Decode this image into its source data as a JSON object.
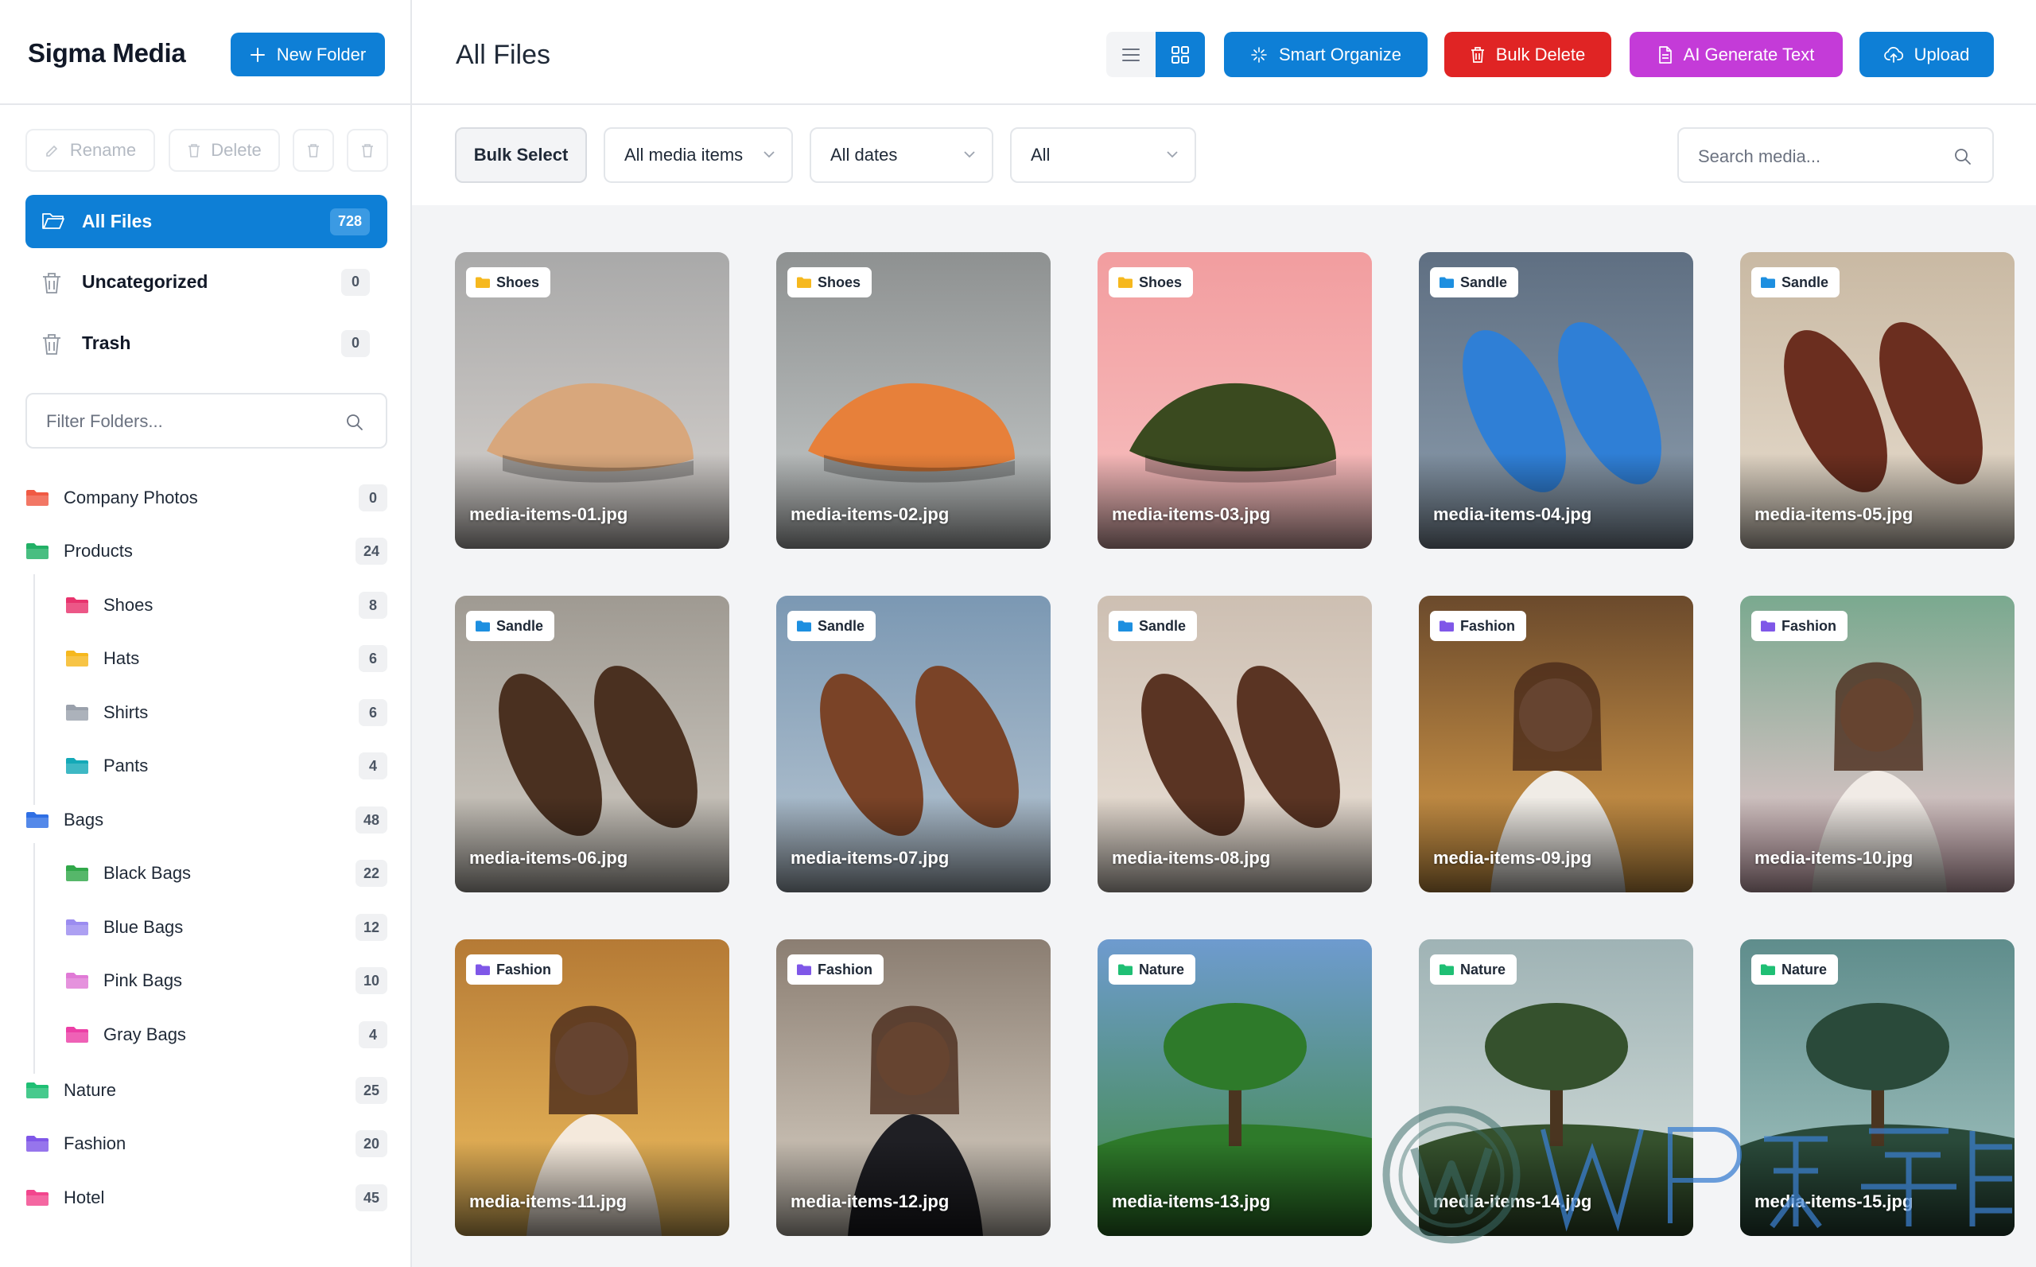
{
  "sidebar": {
    "brand": "Sigma Media",
    "new_folder_label": "New Folder",
    "rename_label": "Rename",
    "delete_label": "Delete",
    "nav": [
      {
        "label": "All Files",
        "count": "728"
      },
      {
        "label": "Uncategorized",
        "count": "0"
      },
      {
        "label": "Trash",
        "count": "0"
      }
    ],
    "filter_placeholder": "Filter Folders...",
    "folders": [
      {
        "label": "Company Photos",
        "count": "0",
        "color": "#f05a44"
      },
      {
        "label": "Products",
        "count": "24",
        "color": "#22b066"
      },
      {
        "label": "Shoes",
        "count": "8",
        "color": "#e8336d"
      },
      {
        "label": "Hats",
        "count": "6",
        "color": "#f6b81e"
      },
      {
        "label": "Shirts",
        "count": "6",
        "color": "#9aa1ac"
      },
      {
        "label": "Pants",
        "count": "4",
        "color": "#14a9b8"
      },
      {
        "label": "Bags",
        "count": "48",
        "color": "#2f6fe4"
      },
      {
        "label": "Black Bags",
        "count": "22",
        "color": "#31a84a"
      },
      {
        "label": "Blue Bags",
        "count": "12",
        "color": "#9b8cf0"
      },
      {
        "label": "Pink Bags",
        "count": "10",
        "color": "#e07ad6"
      },
      {
        "label": "Gray Bags",
        "count": "4",
        "color": "#ec3fa6"
      },
      {
        "label": "Nature",
        "count": "25",
        "color": "#1fbf74"
      },
      {
        "label": "Fashion",
        "count": "20",
        "color": "#7f57e8"
      },
      {
        "label": "Hotel",
        "count": "45",
        "color": "#f2468d"
      }
    ]
  },
  "header": {
    "title": "All Files",
    "smart_organize": "Smart Organize",
    "bulk_delete": "Bulk Delete",
    "ai_generate": "AI Generate Text",
    "upload": "Upload"
  },
  "filters": {
    "bulk_select": "Bulk Select",
    "media_type": "All media items",
    "dates": "All dates",
    "folder": "All",
    "search_placeholder": "Search media..."
  },
  "media": [
    {
      "folder": "Shoes",
      "name": "media-items-01.jpg",
      "folder_color": "#f6b81e"
    },
    {
      "folder": "Shoes",
      "name": "media-items-02.jpg",
      "folder_color": "#f6b81e"
    },
    {
      "folder": "Shoes",
      "name": "media-items-03.jpg",
      "folder_color": "#f6b81e"
    },
    {
      "folder": "Sandle",
      "name": "media-items-04.jpg",
      "folder_color": "#1d8fe0"
    },
    {
      "folder": "Sandle",
      "name": "media-items-05.jpg",
      "folder_color": "#1d8fe0"
    },
    {
      "folder": "Sandle",
      "name": "media-items-06.jpg",
      "folder_color": "#1d8fe0"
    },
    {
      "folder": "Sandle",
      "name": "media-items-07.jpg",
      "folder_color": "#1d8fe0"
    },
    {
      "folder": "Sandle",
      "name": "media-items-08.jpg",
      "folder_color": "#1d8fe0"
    },
    {
      "folder": "Fashion",
      "name": "media-items-09.jpg",
      "folder_color": "#7f57e8"
    },
    {
      "folder": "Fashion",
      "name": "media-items-10.jpg",
      "folder_color": "#7f57e8"
    },
    {
      "folder": "Fashion",
      "name": "media-items-11.jpg",
      "folder_color": "#7f57e8"
    },
    {
      "folder": "Fashion",
      "name": "media-items-12.jpg",
      "folder_color": "#7f57e8"
    },
    {
      "folder": "Nature",
      "name": "media-items-13.jpg",
      "folder_color": "#1fbf74"
    },
    {
      "folder": "Nature",
      "name": "media-items-14.jpg",
      "folder_color": "#1fbf74"
    },
    {
      "folder": "Nature",
      "name": "media-items-15.jpg",
      "folder_color": "#1fbf74"
    }
  ],
  "watermark": "WP资源海",
  "colors": {
    "primary": "#0e7fd6",
    "danger": "#e02424",
    "ai": "#c43bd8"
  }
}
